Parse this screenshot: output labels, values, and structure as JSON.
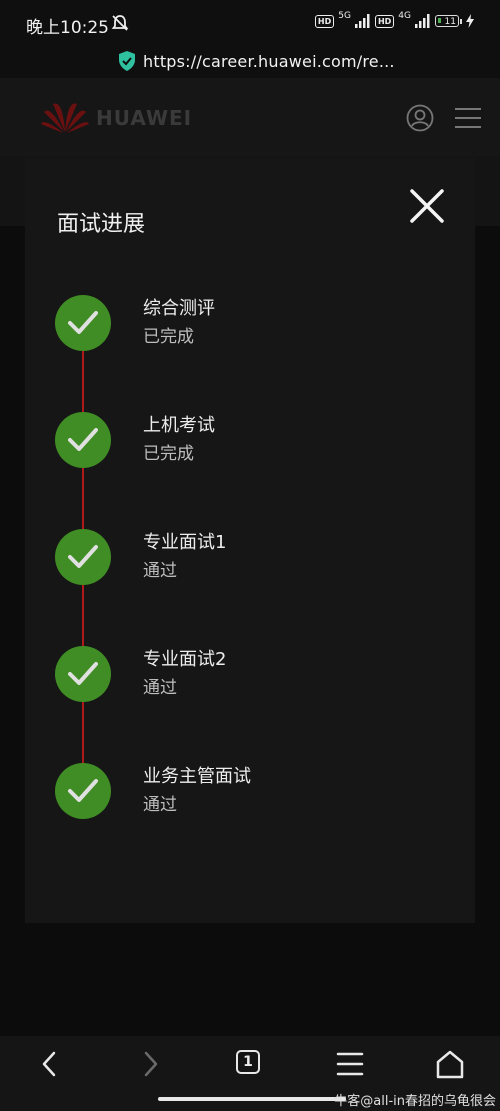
{
  "status_bar": {
    "time": "晚上10:25",
    "network1": "5G",
    "network2": "4G",
    "hd_label": "HD",
    "battery": "11"
  },
  "browser": {
    "url": "https://career.huawei.com/re..."
  },
  "site_header": {
    "logo_text": "HUAWEI"
  },
  "modal": {
    "title": "面试进展",
    "steps": [
      {
        "title": "综合测评",
        "status": "已完成"
      },
      {
        "title": "上机考试",
        "status": "已完成"
      },
      {
        "title": "专业面试1",
        "status": "通过"
      },
      {
        "title": "专业面试2",
        "status": "通过"
      },
      {
        "title": "业务主管面试",
        "status": "通过"
      }
    ]
  },
  "bottom_nav": {
    "tab_count": "1"
  },
  "watermark": "牛客@all-in春招的乌龟很会",
  "colors": {
    "success": "#3f8d24",
    "timeline": "#b01a1a",
    "modal_bg": "#161616"
  }
}
